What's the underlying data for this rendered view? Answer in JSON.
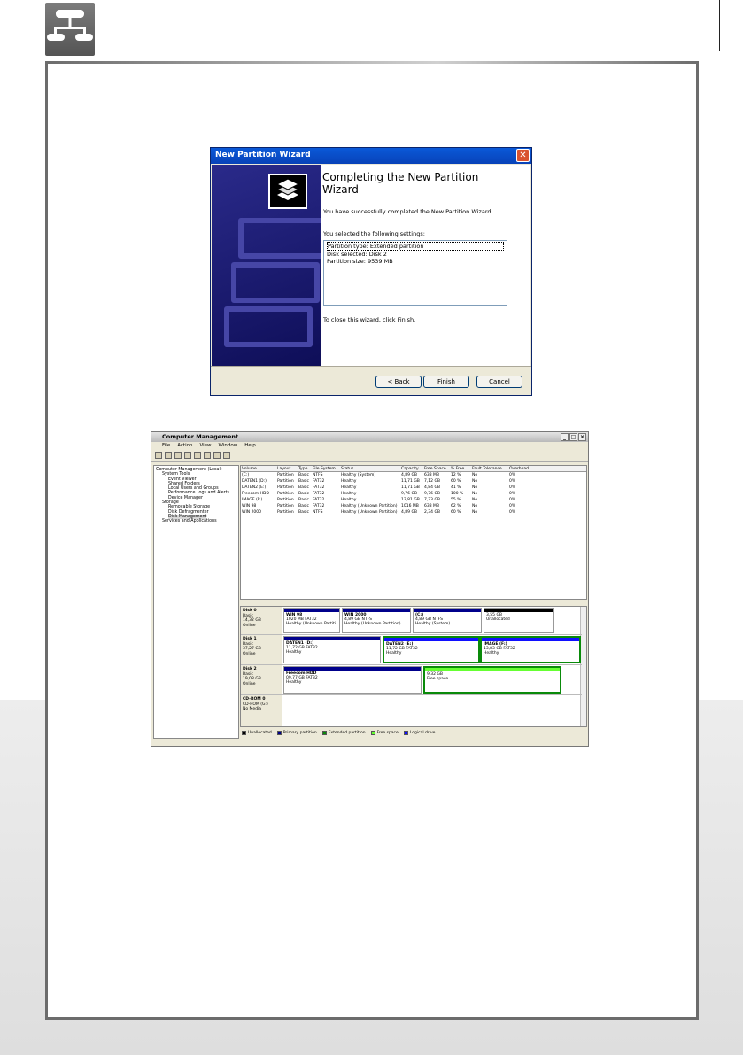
{
  "wizard": {
    "title": "New Partition Wizard",
    "heading": "Completing the New Partition Wizard",
    "success": "You have successfully completed the New Partition Wizard.",
    "settings_label": "You selected the following settings:",
    "settings": [
      "Partition type: Extended partition",
      "Disk selected: Disk 2",
      "Partition size: 9539 MB"
    ],
    "close_hint": "To close this wizard, click Finish.",
    "back": "< Back",
    "finish": "Finish",
    "cancel": "Cancel",
    "close_glyph": "✕"
  },
  "cm": {
    "title": "Computer Management",
    "menu": [
      "File",
      "Action",
      "View",
      "Window",
      "Help"
    ],
    "tree": [
      {
        "label": "Computer Management (Local)",
        "indent": 0
      },
      {
        "label": "System Tools",
        "indent": 1
      },
      {
        "label": "Event Viewer",
        "indent": 2
      },
      {
        "label": "Shared Folders",
        "indent": 2
      },
      {
        "label": "Local Users and Groups",
        "indent": 2
      },
      {
        "label": "Performance Logs and Alerts",
        "indent": 2
      },
      {
        "label": "Device Manager",
        "indent": 2
      },
      {
        "label": "Storage",
        "indent": 1
      },
      {
        "label": "Removable Storage",
        "indent": 2
      },
      {
        "label": "Disk Defragmenter",
        "indent": 2
      },
      {
        "label": "Disk Management",
        "indent": 2,
        "selected": true
      },
      {
        "label": "Services and Applications",
        "indent": 1
      }
    ],
    "columns": [
      "Volume",
      "Layout",
      "Type",
      "File System",
      "Status",
      "Capacity",
      "Free Space",
      "% Free",
      "Fault Tolerance",
      "Overhead"
    ],
    "volumes": [
      [
        "(C:)",
        "Partition",
        "Basic",
        "NTFS",
        "Healthy (System)",
        "4,89 GB",
        "638 MB",
        "12 %",
        "No",
        "0%"
      ],
      [
        "DATEN1 (D:)",
        "Partition",
        "Basic",
        "FAT32",
        "Healthy",
        "11,71 GB",
        "7,12 GB",
        "60 %",
        "No",
        "0%"
      ],
      [
        "DATEN2 (E:)",
        "Partition",
        "Basic",
        "FAT32",
        "Healthy",
        "11,71 GB",
        "4,84 GB",
        "41 %",
        "No",
        "0%"
      ],
      [
        "Freecom HDD",
        "Partition",
        "Basic",
        "FAT32",
        "Healthy",
        "9,76 GB",
        "9,76 GB",
        "100 %",
        "No",
        "0%"
      ],
      [
        "IMAGE (F:)",
        "Partition",
        "Basic",
        "FAT32",
        "Healthy",
        "13,81 GB",
        "7,73 GB",
        "55 %",
        "No",
        "0%"
      ],
      [
        "WIN 98",
        "Partition",
        "Basic",
        "FAT32",
        "Healthy (Unknown Partition)",
        "1016 MB",
        "638 MB",
        "62 %",
        "No",
        "0%"
      ],
      [
        "WIN 2000",
        "Partition",
        "Basic",
        "NTFS",
        "Healthy (Unknown Partition)",
        "4,89 GB",
        "2,34 GB",
        "60 %",
        "No",
        "0%"
      ]
    ],
    "disks": [
      {
        "name": "Disk 0",
        "type": "Basic",
        "size": "14,32 GB",
        "status": "Online",
        "parts": [
          {
            "name": "WIN 98",
            "size": "1020 MB FAT32",
            "status": "Healthy (Unknown Partiti",
            "kind": "primary"
          },
          {
            "name": "WIN 2000",
            "size": "4,89 GB NTFS",
            "status": "Healthy (Unknown Partition)",
            "kind": "primary"
          },
          {
            "name": "(C:)",
            "size": "4,89 GB NTFS",
            "status": "Healthy (System)",
            "kind": "primary"
          },
          {
            "name": "",
            "size": "3,55 GB",
            "status": "Unallocated",
            "kind": "unallocated"
          }
        ]
      },
      {
        "name": "Disk 1",
        "type": "Basic",
        "size": "37,27 GB",
        "status": "Online",
        "parts": [
          {
            "name": "DATEN1 (D:)",
            "size": "11,72 GB FAT32",
            "status": "Healthy",
            "kind": "primary"
          },
          {
            "name": "DATEN2 (E:)",
            "size": "11,72 GB FAT32",
            "status": "Healthy",
            "kind": "logical"
          },
          {
            "name": "IMAGE (F:)",
            "size": "13,83 GB FAT32",
            "status": "Healthy",
            "kind": "logical"
          }
        ]
      },
      {
        "name": "Disk 2",
        "type": "Basic",
        "size": "19,08 GB",
        "status": "Online",
        "parts": [
          {
            "name": "Freecom HDD",
            "size": "09,77 GB FAT32",
            "status": "Healthy",
            "kind": "primary"
          },
          {
            "name": "",
            "size": "9,32 GB",
            "status": "Free space",
            "kind": "free"
          }
        ]
      },
      {
        "name": "CD-ROM 0",
        "type": "CD-ROM (G:)",
        "size": "",
        "status": "No Media",
        "parts": []
      }
    ],
    "legend": [
      {
        "label": "Unallocated",
        "color": "#000000"
      },
      {
        "label": "Primary partition",
        "color": "#00008b"
      },
      {
        "label": "Extended partition",
        "color": "#0a8a0a"
      },
      {
        "label": "Free space",
        "color": "#66ff33"
      },
      {
        "label": "Logical drive",
        "color": "#1010ff"
      }
    ]
  }
}
